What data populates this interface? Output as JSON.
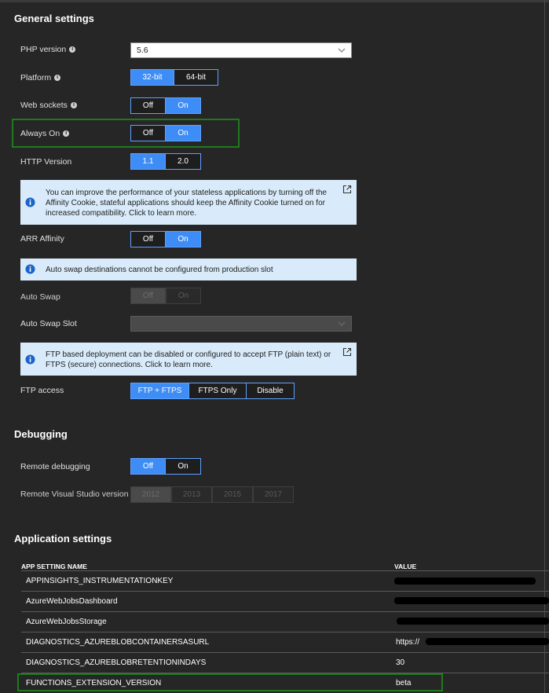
{
  "general": {
    "title": "General settings",
    "php_version": {
      "label": "PHP version",
      "value": "5.6"
    },
    "platform": {
      "label": "Platform",
      "options": [
        "32-bit",
        "64-bit"
      ]
    },
    "web_sockets": {
      "label": "Web sockets",
      "options": [
        "Off",
        "On"
      ]
    },
    "always_on": {
      "label": "Always On",
      "options": [
        "Off",
        "On"
      ]
    },
    "http_version": {
      "label": "HTTP Version",
      "options": [
        "1.1",
        "2.0"
      ]
    },
    "affinity_info": "You can improve the performance of your stateless applications by turning off the Affinity Cookie, stateful applications should keep the Affinity Cookie turned on for increased compatibility. Click to learn more.",
    "arr_affinity": {
      "label": "ARR Affinity",
      "options": [
        "Off",
        "On"
      ]
    },
    "swap_info": "Auto swap destinations cannot be configured from production slot",
    "auto_swap": {
      "label": "Auto Swap",
      "options": [
        "Off",
        "On"
      ]
    },
    "auto_swap_slot": {
      "label": "Auto Swap Slot"
    },
    "ftp_info": "FTP based deployment can be disabled or configured to accept FTP (plain text) or FTPS (secure) connections. Click to learn more.",
    "ftp_access": {
      "label": "FTP access",
      "options": [
        "FTP + FTPS",
        "FTPS Only",
        "Disable"
      ]
    }
  },
  "debugging": {
    "title": "Debugging",
    "remote_debugging": {
      "label": "Remote debugging",
      "options": [
        "Off",
        "On"
      ]
    },
    "remote_vs_version": {
      "label": "Remote Visual Studio version",
      "options": [
        "2012",
        "2013",
        "2015",
        "2017"
      ]
    }
  },
  "app_settings": {
    "title": "Application settings",
    "col_name": "APP SETTING NAME",
    "col_value": "VALUE",
    "rows": [
      {
        "name": "APPINSIGHTS_INSTRUMENTATIONKEY",
        "value": ""
      },
      {
        "name": "AzureWebJobsDashboard",
        "value": ""
      },
      {
        "name": "AzureWebJobsStorage",
        "value": ""
      },
      {
        "name": "DIAGNOSTICS_AZUREBLOBCONTAINERSASURL",
        "value": "https://"
      },
      {
        "name": "DIAGNOSTICS_AZUREBLOBRETENTIONINDAYS",
        "value": "30"
      },
      {
        "name": "FUNCTIONS_EXTENSION_VERSION",
        "value": "beta"
      }
    ]
  },
  "icons": {
    "info": "info-icon",
    "external": "external-link-icon",
    "chevron": "chevron-down-icon"
  },
  "colors": {
    "accent": "#3e8df6",
    "highlight": "#1f7a1f",
    "info_bg": "#d9ebfa"
  }
}
